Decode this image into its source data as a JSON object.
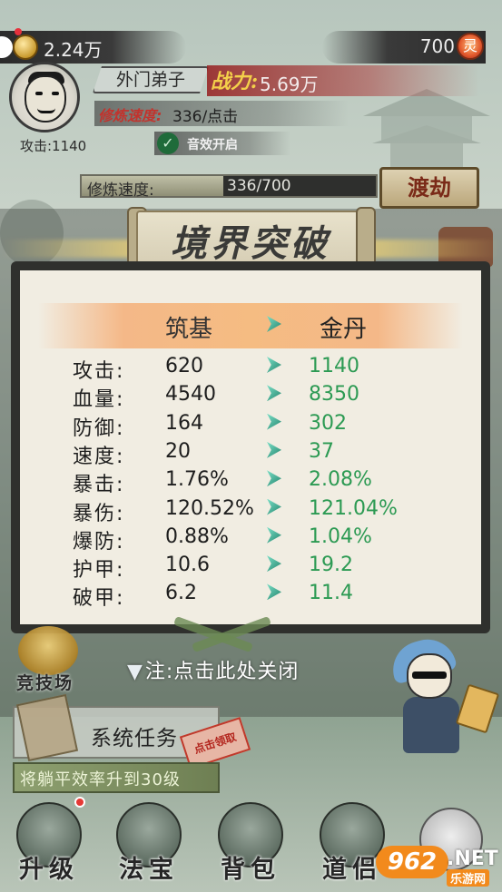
{
  "topbar": {
    "coins": "2.24万",
    "gems": "700",
    "gem_icon": "灵"
  },
  "player": {
    "rank": "外门弟子",
    "power_label": "战力:",
    "power_value": "5.69万",
    "cultivate_label": "修炼速度:",
    "cultivate_value": "336/点击",
    "attack": "攻击:1140",
    "sound": "音效开启"
  },
  "progress": {
    "label": "修炼速度:",
    "value": "336/700",
    "fraction": 0.48,
    "button": "渡劫"
  },
  "modal": {
    "title": "境界突破",
    "from_realm": "筑基",
    "to_realm": "金丹",
    "stats": [
      {
        "name": "攻击:",
        "old": "620",
        "new": "1140"
      },
      {
        "name": "血量:",
        "old": "4540",
        "new": "8350"
      },
      {
        "name": "防御:",
        "old": "164",
        "new": "302"
      },
      {
        "name": "速度:",
        "old": "20",
        "new": "37"
      },
      {
        "name": "暴击:",
        "old": "1.76%",
        "new": "2.08%"
      },
      {
        "name": "暴伤:",
        "old": "120.52%",
        "new": "121.04%"
      },
      {
        "name": "爆防:",
        "old": "0.88%",
        "new": "1.04%"
      },
      {
        "name": "护甲:",
        "old": "10.6",
        "new": "19.2"
      },
      {
        "name": "破甲:",
        "old": "6.2",
        "new": "11.4"
      }
    ],
    "close_hint": "注:点击此处关闭"
  },
  "side": {
    "arena": "竞技场"
  },
  "task": {
    "title": "系统任务",
    "claim": "点击领取",
    "desc": "将躺平效率升到30级"
  },
  "nav": {
    "items": [
      {
        "label": "升级"
      },
      {
        "label": "法宝"
      },
      {
        "label": "背包"
      },
      {
        "label": "道侣"
      }
    ]
  },
  "watermark": {
    "logo": "962",
    "net": ".NET",
    "sub": "乐游网"
  }
}
